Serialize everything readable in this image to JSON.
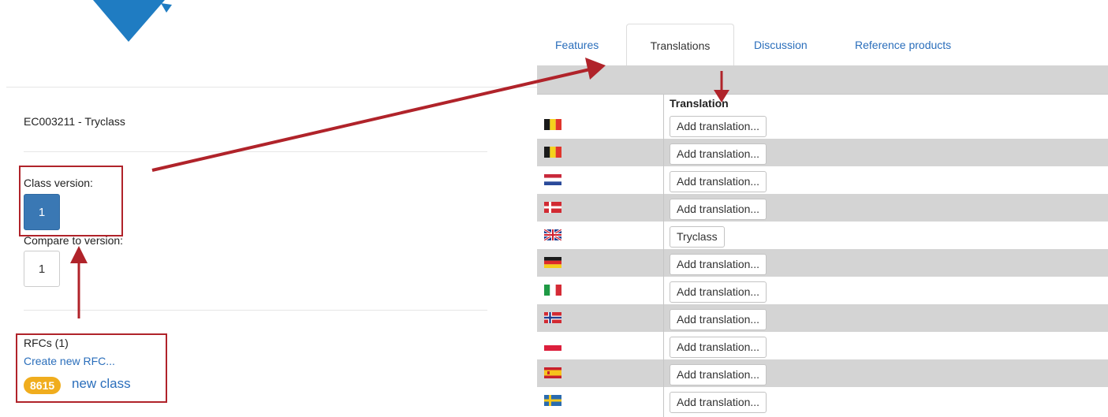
{
  "left": {
    "class_title": "EC003211 - Tryclass",
    "class_version_label": "Class version:",
    "class_version_value": "1",
    "compare_label": "Compare to version:",
    "compare_value": "1",
    "rfcs_label": "RFCs (1)",
    "create_rfc_link": "Create new RFC...",
    "rfc_badge": "8615",
    "rfc_title": "new class"
  },
  "tabs": [
    {
      "label": "Features",
      "active": false
    },
    {
      "label": "Translations",
      "active": true
    },
    {
      "label": "Discussion",
      "active": false
    },
    {
      "label": "Reference products",
      "active": false
    }
  ],
  "grid": {
    "column_header": "Translation",
    "rows": [
      {
        "flag": "belgium-flag-icon",
        "text": "Add translation..."
      },
      {
        "flag": "belgium-flag-icon",
        "text": "Add translation..."
      },
      {
        "flag": "netherlands-flag-icon",
        "text": "Add translation..."
      },
      {
        "flag": "denmark-flag-icon",
        "text": "Add translation..."
      },
      {
        "flag": "uk-flag-icon",
        "text": "Tryclass"
      },
      {
        "flag": "germany-flag-icon",
        "text": "Add translation..."
      },
      {
        "flag": "italy-flag-icon",
        "text": "Add translation..."
      },
      {
        "flag": "norway-flag-icon",
        "text": "Add translation..."
      },
      {
        "flag": "poland-flag-icon",
        "text": "Add translation..."
      },
      {
        "flag": "spain-flag-icon",
        "text": "Add translation..."
      },
      {
        "flag": "sweden-flag-icon",
        "text": "Add translation..."
      }
    ]
  },
  "colors": {
    "link": "#2a6ebb",
    "active_version": "#3a78b4",
    "badge": "#f0ad1e",
    "annotation_red": "#b0232a"
  }
}
